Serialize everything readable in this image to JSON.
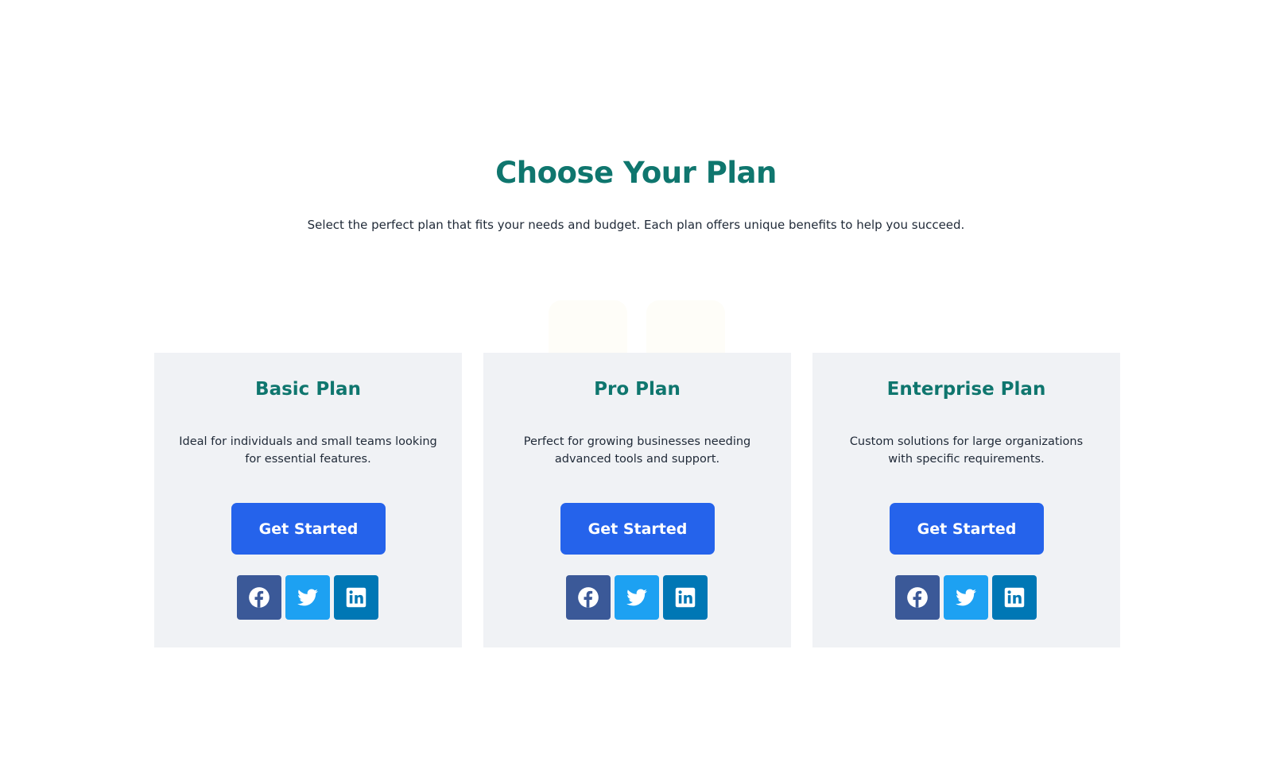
{
  "header": {
    "title": "Choose Your Plan",
    "subtitle": "Select the perfect plan that fits your needs and budget. Each plan offers unique benefits to help you succeed."
  },
  "plans": [
    {
      "title": "Basic Plan",
      "description": "Ideal for individuals and small teams looking for essential features.",
      "cta_label": "Get Started",
      "socials": [
        "facebook-icon",
        "twitter-icon",
        "linkedin-icon"
      ]
    },
    {
      "title": "Pro Plan",
      "description": "Perfect for growing businesses needing advanced tools and support.",
      "cta_label": "Get Started",
      "socials": [
        "facebook-icon",
        "twitter-icon",
        "linkedin-icon"
      ]
    },
    {
      "title": "Enterprise Plan",
      "description": "Custom solutions for large organizations with specific requirements.",
      "cta_label": "Get Started",
      "socials": [
        "facebook-icon",
        "twitter-icon",
        "linkedin-icon"
      ]
    }
  ],
  "colors": {
    "accent": "#0f766e",
    "button": "#2563eb",
    "card_bg": "#f0f2f5",
    "facebook": "#3b5998",
    "twitter": "#1da1f2",
    "linkedin": "#0077b5"
  }
}
